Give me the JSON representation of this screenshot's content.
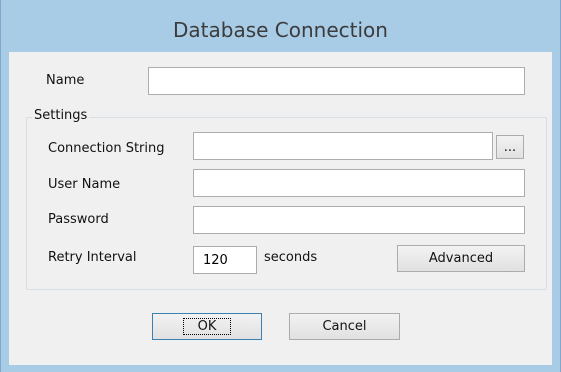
{
  "dialog": {
    "title": "Database Connection"
  },
  "name_field": {
    "label": "Name",
    "value": ""
  },
  "settings": {
    "group_label": "Settings",
    "connection_string": {
      "label": "Connection String",
      "value": "",
      "browse_label": "..."
    },
    "user_name": {
      "label": "User Name",
      "value": ""
    },
    "password": {
      "label": "Password",
      "value": ""
    },
    "retry_interval": {
      "label": "Retry Interval",
      "value": "120",
      "unit": "seconds"
    },
    "advanced_label": "Advanced"
  },
  "buttons": {
    "ok_label": "OK",
    "cancel_label": "Cancel"
  }
}
